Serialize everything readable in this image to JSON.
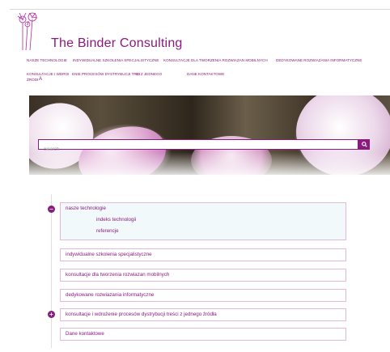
{
  "site": {
    "title": "The Binder Consulting"
  },
  "nav": {
    "items": [
      "NASZE TECHNOLOGIE",
      "INDYWIDUALNE SZKOLENIA SPECJALISTYCZNE",
      "KONSULTACJE DLA TWORZENIA ROZWIAZAN MOBILNYCH",
      "DEDYKOWANE ROZWIAZANIA INFORMATYCZNE",
      "KONSULTACJE I WDROI",
      "ENIE PROCESÓW DYSTRYBUCJI TREI",
      "CI Z JEDNEGO",
      "DANE KONTAKTOWE",
      "ŹRÓDI",
      "A"
    ]
  },
  "search": {
    "placeholder": "Search",
    "button_icon": "search-icon"
  },
  "tree": {
    "items": [
      {
        "label": "nasze technologie",
        "children": [
          "indeks technologii",
          "referencje"
        ],
        "toggle": "−"
      },
      {
        "label": "indywidualne szkolenia specjalistyczne"
      },
      {
        "label": "konsultacje dla tworzenia rozwiazan mobilnych"
      },
      {
        "label": "dedykowane rozwiazania informatyczne"
      },
      {
        "label": "konsultacje i wdrożenie procesów dystrybucji treści z jednego źródła",
        "toggle": "+"
      },
      {
        "label": "Dane kontaktowe"
      }
    ]
  },
  "colors": {
    "brand": "#8a1a7e",
    "border": "#e0b9da",
    "expanded_bg": "#f1f9fb"
  }
}
